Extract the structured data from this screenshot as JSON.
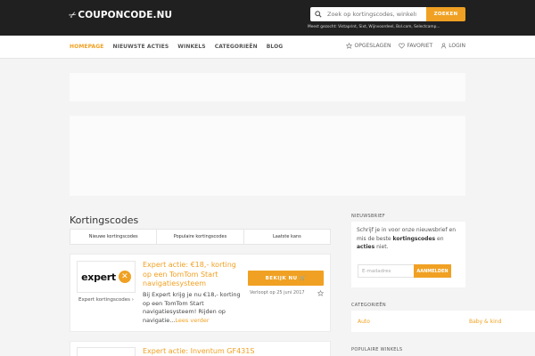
{
  "header": {
    "logo_scissor": "✂",
    "logo_text": "COUPONCODE.NU",
    "search": {
      "placeholder": "Zoek op kortingscodes, winkels...",
      "button_label": "ZOEKEN",
      "icon": "search-icon"
    },
    "popular_searches": "Meest gezocht:  Vistaprint, Sixt, Wijnvoordeel, Bol.com, Selectcamp..."
  },
  "nav": {
    "items": [
      {
        "label": "HOMEPAGE",
        "active": true
      },
      {
        "label": "NIEUWSTE ACTIES",
        "active": false
      },
      {
        "label": "WINKELS",
        "active": false
      },
      {
        "label": "CATEGORIEËN",
        "active": false
      },
      {
        "label": "BLOG",
        "active": false
      }
    ],
    "right": {
      "saved": "OPGESLAGEN",
      "favorites": "FAVORIET",
      "login": "LOGIN"
    }
  },
  "main": {
    "title": "Kortingscodes",
    "tabs": [
      {
        "label": "Nieuwe kortingscodes"
      },
      {
        "label": "Populaire kortingscodes"
      },
      {
        "label": "Laatste kans"
      }
    ],
    "deals": [
      {
        "shop_logo_text": "expert",
        "shop_badge": "✕",
        "shop_link": "Expert kortingscodes ›",
        "title": "Expert actie: €18,- korting op een TomTom Start navigatiesysteem",
        "description": "Bij Expert krijg je nu €18,- korting op een TomTom Start navigatiesysteem! Rijden op navigatie...",
        "more": "Lees verder",
        "cta": "BEKIJK NU 🛒",
        "expires": "Verloopt op 25 juni 2017"
      },
      {
        "title": "Expert actie: Inventum GF431S"
      }
    ]
  },
  "sidebar": {
    "newsletter": {
      "label": "NIEUWSBRIEF",
      "text_1": "Schrijf je in voor onze nieuwsbrief en mis de beste ",
      "bold_1": "kortingscodes",
      "text_2": " en ",
      "bold_2": "acties",
      "text_3": " niet.",
      "input_placeholder": "E-mailadres",
      "button": "AANMELDEN"
    },
    "categories": {
      "label": "CATEGORIEËN",
      "items": [
        "Auto",
        "Baby & kind"
      ]
    },
    "popular_shops_label": "POPULAIRE WINKELS"
  },
  "colors": {
    "accent": "#f0a123",
    "header_bg": "#202020",
    "page_bg": "#f4f4f4"
  }
}
